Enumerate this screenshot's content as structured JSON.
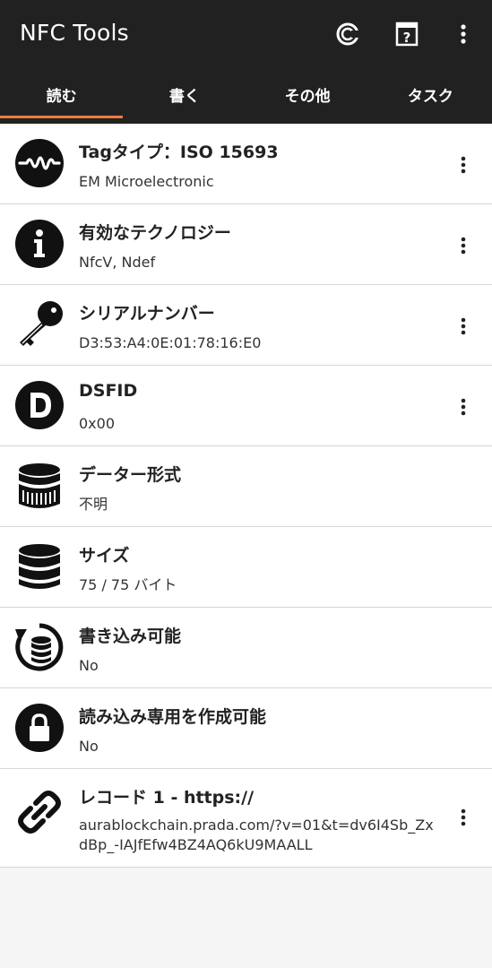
{
  "app": {
    "title": "NFC Tools"
  },
  "tabs": [
    {
      "label": "読む",
      "active": true
    },
    {
      "label": "書く",
      "active": false
    },
    {
      "label": "その他",
      "active": false
    },
    {
      "label": "タスク",
      "active": false
    }
  ],
  "accent_color": "#f07a3c",
  "toolbar_icons": [
    "coin-icon",
    "help-book-icon",
    "more-vertical-icon"
  ],
  "items": [
    {
      "icon": "waveform-icon",
      "title": "Tagタイプ：ISO 15693",
      "value": "EM Microelectronic",
      "menu": true
    },
    {
      "icon": "info-icon",
      "title": "有効なテクノロジー",
      "value": "NfcV, Ndef",
      "menu": true
    },
    {
      "icon": "key-icon",
      "title": "シリアルナンバー",
      "value": "D3:53:A4:0E:01:78:16:E0",
      "menu": true
    },
    {
      "icon": "dsfid-icon",
      "title": "DSFID",
      "value": "0x00",
      "menu": true
    },
    {
      "icon": "database-format-icon",
      "title": "データー形式",
      "value": "不明",
      "menu": false
    },
    {
      "icon": "database-icon",
      "title": "サイズ",
      "value": "75 / 75 バイト",
      "menu": false
    },
    {
      "icon": "rewritable-icon",
      "title": "書き込み可能",
      "value": "No",
      "menu": false
    },
    {
      "icon": "lock-icon",
      "title": "読み込み専用を作成可能",
      "value": "No",
      "menu": false
    },
    {
      "icon": "link-icon",
      "title": "レコード 1 - https://",
      "value": "aurablockchain.prada.com/?v=01&t=dv6I4Sb_ZxdBp_-IAJfEfw4BZ4AQ6kU9MAALL",
      "menu": true
    }
  ]
}
